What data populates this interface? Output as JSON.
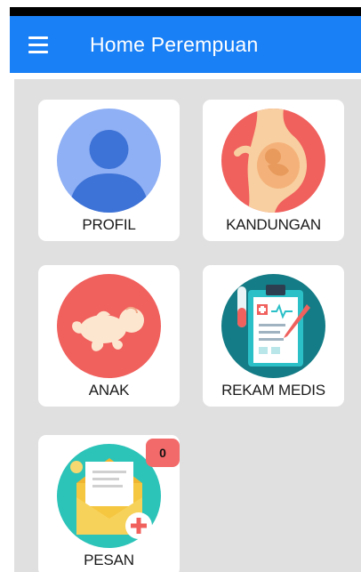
{
  "app": {
    "title": "Home Perempuan",
    "accent": "#1a80f5"
  },
  "menu": [
    {
      "id": "profil",
      "label": "PROFIL",
      "icon": "user-icon"
    },
    {
      "id": "kandungan",
      "label": "KANDUNGAN",
      "icon": "pregnancy-icon"
    },
    {
      "id": "anak",
      "label": "ANAK",
      "icon": "baby-icon"
    },
    {
      "id": "rekam-medis",
      "label": "REKAM MEDIS",
      "icon": "medical-record-icon"
    },
    {
      "id": "pesan",
      "label": "PESAN",
      "icon": "mail-icon",
      "badge": "0"
    }
  ]
}
